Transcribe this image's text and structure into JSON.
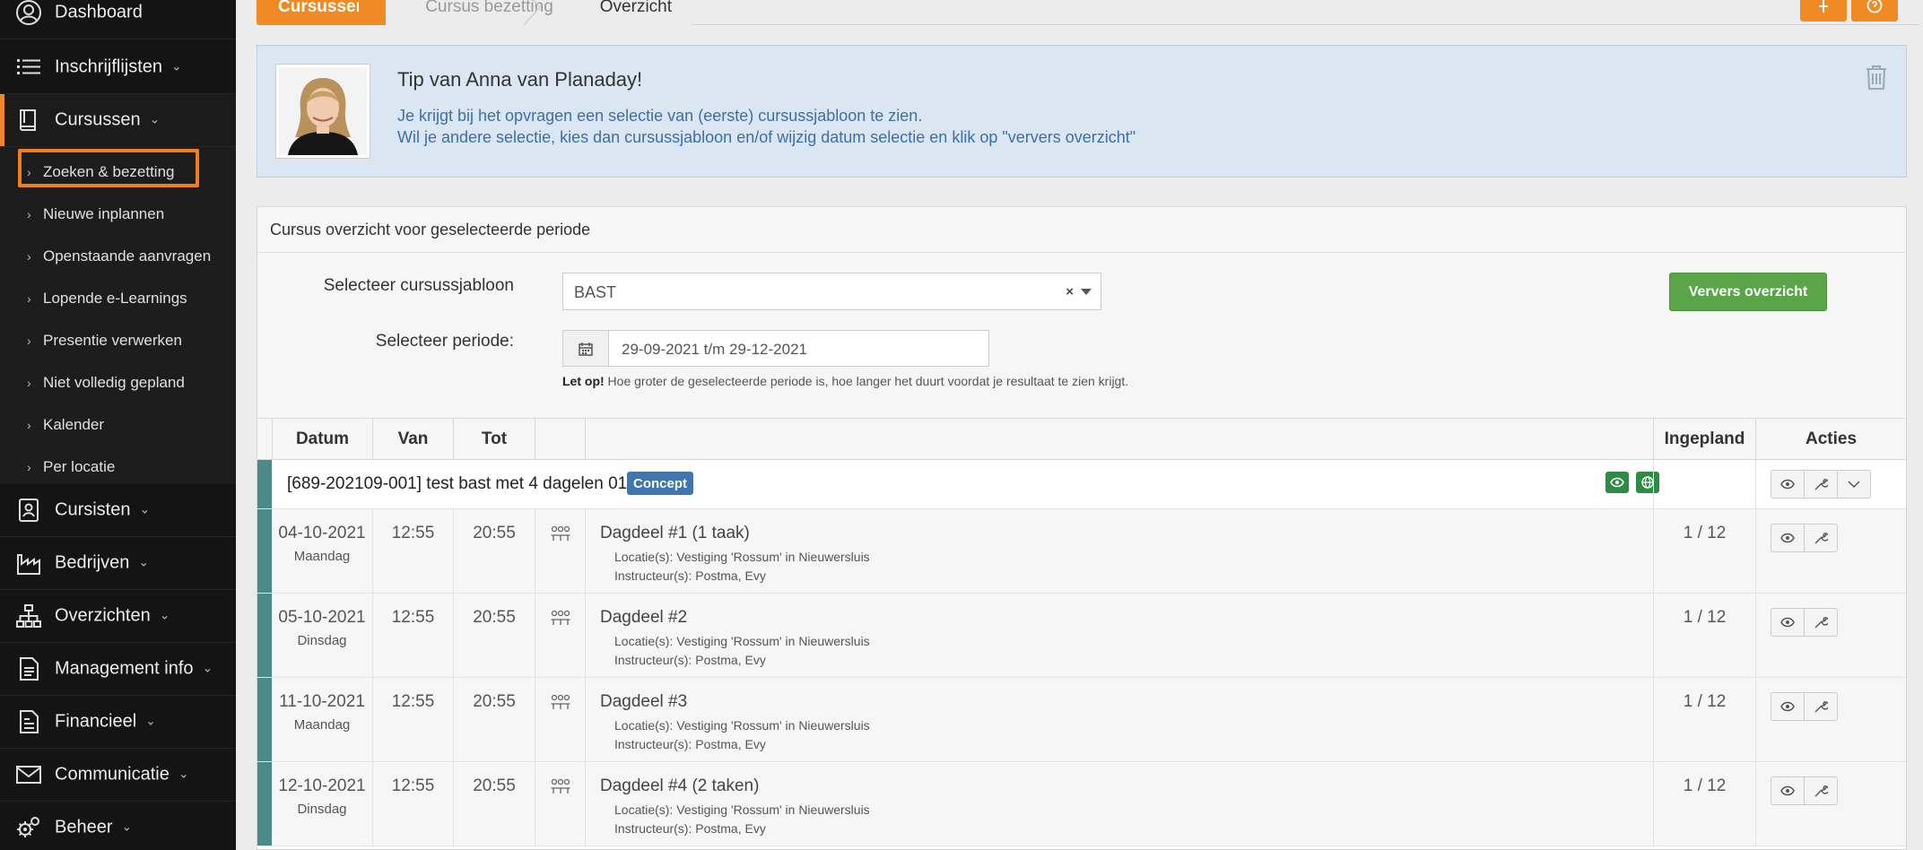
{
  "sidebar": {
    "items": [
      {
        "label": "Dashboard",
        "icon": "user-circle-icon",
        "chevron": ""
      },
      {
        "label": "Inschrijflijsten",
        "icon": "list-icon",
        "chevron": "⌄"
      },
      {
        "label": "Cursussen",
        "icon": "book-icon",
        "chevron": "⌄"
      },
      {
        "label": "Cursisten",
        "icon": "id-card-icon",
        "chevron": "⌄"
      },
      {
        "label": "Bedrijven",
        "icon": "factory-icon",
        "chevron": "⌄"
      },
      {
        "label": "Overzichten",
        "icon": "org-chart-icon",
        "chevron": "⌄"
      },
      {
        "label": "Management info",
        "icon": "document-icon",
        "chevron": "⌄"
      },
      {
        "label": "Financieel",
        "icon": "invoice-icon",
        "chevron": "⌄"
      },
      {
        "label": "Communicatie",
        "icon": "envelope-icon",
        "chevron": "⌄"
      },
      {
        "label": "Beheer",
        "icon": "gears-icon",
        "chevron": "⌄"
      }
    ],
    "submenu": [
      {
        "label": "Zoeken & bezetting"
      },
      {
        "label": "Nieuwe inplannen"
      },
      {
        "label": "Openstaande aanvragen"
      },
      {
        "label": "Lopende e-Learnings"
      },
      {
        "label": "Presentie verwerken"
      },
      {
        "label": "Niet volledig gepland"
      },
      {
        "label": "Kalender"
      },
      {
        "label": "Per locatie"
      }
    ],
    "submenu_arrow": "›"
  },
  "breadcrumb": [
    "Cursussen",
    "Cursus bezetting",
    "Overzicht"
  ],
  "tip": {
    "title": "Tip van Anna van Planaday!",
    "line1": "Je krijgt bij het opvragen een selectie van (eerste) cursussjabloon te zien.",
    "line2": "Wil je andere selectie, kies dan cursussjabloon en/of wijzig datum selectie en klik op \"ververs overzicht\""
  },
  "panel": {
    "title": "Cursus overzicht voor geselecteerde periode",
    "label_sjabloon": "Selecteer cursussjabloon",
    "sjabloon_value": "BAST",
    "select_clear": "×",
    "label_periode": "Selecteer periode:",
    "periode_value": "29-09-2021 t/m 29-12-2021",
    "refresh_button": "Ververs overzicht",
    "note_bold": "Let op!",
    "note_text": " Hoe groter de geselecteerde periode is, hoe langer het duurt voordat je resultaat te zien krijgt."
  },
  "table": {
    "headers": {
      "datum": "Datum",
      "van": "Van",
      "tot": "Tot",
      "icon": "",
      "title": "",
      "ingepland": "Ingepland",
      "acties": "Acties"
    },
    "group": {
      "title": "[689-202109-001] test bast met 4 dagelen 01",
      "badge": "Concept"
    },
    "rows": [
      {
        "date": "04-10-2021",
        "day": "Maandag",
        "van": "12:55",
        "tot": "20:55",
        "title": "Dagdeel #1 (1 taak)",
        "locatie": "Locatie(s): Vestiging 'Rossum' in Nieuwersluis",
        "instructeur": "Instructeur(s): Postma, Evy",
        "ingepland": "1 / 12"
      },
      {
        "date": "05-10-2021",
        "day": "Dinsdag",
        "van": "12:55",
        "tot": "20:55",
        "title": "Dagdeel #2",
        "locatie": "Locatie(s): Vestiging 'Rossum' in Nieuwersluis",
        "instructeur": "Instructeur(s): Postma, Evy",
        "ingepland": "1 / 12"
      },
      {
        "date": "11-10-2021",
        "day": "Maandag",
        "van": "12:55",
        "tot": "20:55",
        "title": "Dagdeel #3",
        "locatie": "Locatie(s): Vestiging 'Rossum' in Nieuwersluis",
        "instructeur": "Instructeur(s): Postma, Evy",
        "ingepland": "1 / 12"
      },
      {
        "date": "12-10-2021",
        "day": "Dinsdag",
        "van": "12:55",
        "tot": "20:55",
        "title": "Dagdeel #4 (2 taken)",
        "locatie": "Locatie(s): Vestiging 'Rossum' in Nieuwersluis",
        "instructeur": "Instructeur(s): Postma, Evy",
        "ingepland": "1 / 12"
      }
    ]
  },
  "colors": {
    "accent_orange": "#f08a24",
    "sidebar_bg": "#141414",
    "tip_bg": "#dae6f2",
    "green": "#5aa548",
    "row_stripe": "#4a8b87",
    "badge_blue": "#3e76ad"
  }
}
